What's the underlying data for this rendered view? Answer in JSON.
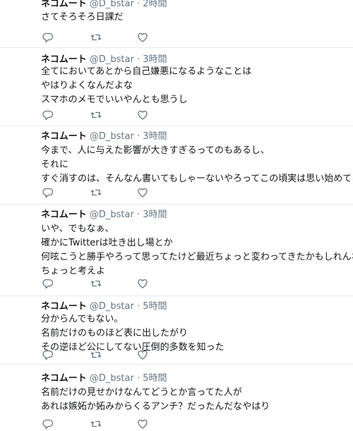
{
  "tweets": [
    {
      "name": "ネコムート",
      "handle": "@D_bstar",
      "separator": "·",
      "time": "2時間",
      "lines": [
        "さてそろそろ日課だ"
      ]
    },
    {
      "name": "ネコムート",
      "handle": "@D_bstar",
      "separator": "·",
      "time": "3時間",
      "lines": [
        "全てにおいてあとから自己嫌悪になるようなことは",
        "やはりよくなんだよな",
        "スマホのメモでいいやんとも思うし"
      ]
    },
    {
      "name": "ネコムート",
      "handle": "@D_bstar",
      "separator": "·",
      "time": "3時間",
      "lines": [
        "今まで、人に与えた影響が大きすぎるってのもあるし、",
        "それに",
        "すぐ消すのは、そんなん書いてもしゃーないやろってこの頃実は思い始めてる"
      ]
    },
    {
      "name": "ネコムート",
      "handle": "@D_bstar",
      "separator": "·",
      "time": "3時間",
      "lines": [
        "いや、でもなぁ、",
        "確かにTwitterは吐き出し場とか",
        "何呟こうと勝手やろって思ってたけど最近ちょっと変わってきたかもしれんなぁ",
        "ちょっと考えよ"
      ]
    },
    {
      "name": "ネコムート",
      "handle": "@D_bstar",
      "separator": "·",
      "time": "5時間",
      "lines": [
        "分からんでもない。",
        "名前だけのものほど表に出したがり",
        "その逆ほど公にしてない圧倒的多数を知った"
      ]
    },
    {
      "name": "ネコムート",
      "handle": "@D_bstar",
      "separator": "·",
      "time": "5時間",
      "lines": [
        "名前だけの見せかけなんてどうとか言ってた人が",
        "あれは嫉妬か妬みからくるアンチ？だったんだなやはり"
      ]
    }
  ],
  "icons": {
    "reply": "reply-icon",
    "retweet": "retweet-icon",
    "like": "like-icon"
  },
  "colors": {
    "text": "#14171a",
    "secondary": "#657786",
    "divider": "#e6ecf0"
  }
}
